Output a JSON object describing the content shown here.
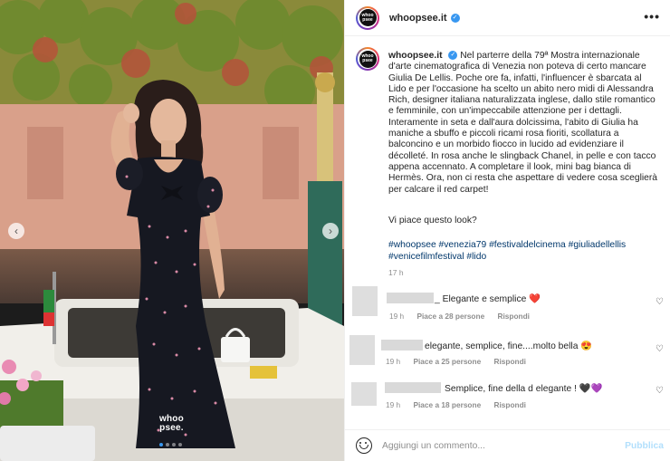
{
  "post": {
    "username": "whoopsee.it",
    "avatar_text": "whoo psee",
    "more_icon": "•••",
    "caption": "Nel parterre della 79ª Mostra internazionale d'arte cinematografica di Venezia non poteva di certo mancare Giulia De Lellis. Poche ore fa, infatti, l'influencer è sbarcata al Lido e per l'occasione ha scelto un abito nero midi di Alessandra Rich, designer italiana naturalizzata inglese, dallo stile romantico e femminile, con un'impeccabile attenzione per i dettagli. Interamente in seta e dall'aura dolcissima, l'abito di Giulia ha maniche a sbuffo e piccoli ricami rosa fioriti, scollatura a balconcino e un morbido fiocco in lucido ad evidenziare il décolleté. In rosa anche le slingback Chanel, in pelle e con tacco appena accennato. A completare il look, mini bag bianca di Hermès. Ora, non ci resta che aspettare di vedere cosa sceglierà per calcare il red carpet!",
    "question": "Vi piace questo look?",
    "hashtags": "#whoopsee #venezia79 #festivaldelcinema #giuliadellellis #venicefilmfestival #lido",
    "time": "17 h"
  },
  "photo": {
    "watermark_line1": "whoo",
    "watermark_line2": "psee.",
    "prev_icon": "‹",
    "next_icon": "›"
  },
  "comments": [
    {
      "text": "_ Elegante e semplice ❤️",
      "time": "19 h",
      "likes": "Piace a 28 persone",
      "reply": "Rispondi"
    },
    {
      "text": "elegante, semplice, fine....molto bella 😍",
      "time": "19 h",
      "likes": "Piace a 25 persone",
      "reply": "Rispondi"
    },
    {
      "text": "Semplice, fine della d elegante ! 🖤💜",
      "time": "19 h",
      "likes": "Piace a 18 persone",
      "reply": "Rispondi"
    }
  ],
  "comment_bar": {
    "placeholder": "Aggiungi un commento...",
    "publish": "Pubblica"
  },
  "colors": {
    "accent": "#3897f0",
    "link": "#00376b",
    "publish_disabled": "#b2dffc"
  }
}
